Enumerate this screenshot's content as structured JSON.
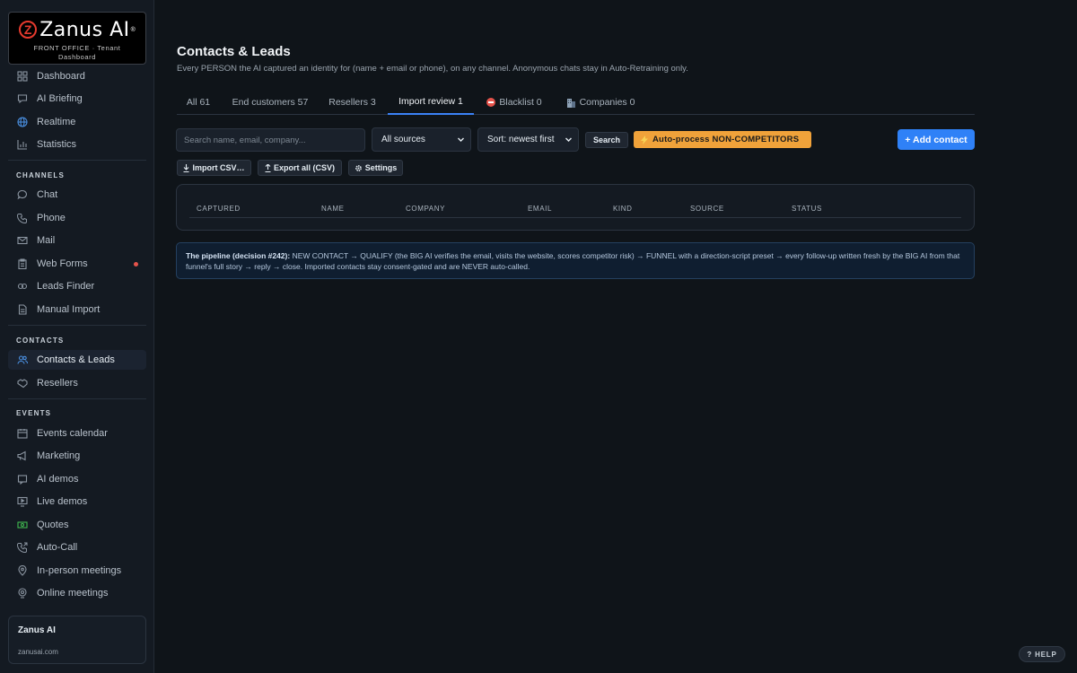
{
  "brand": {
    "name": "Zanus AI",
    "registered": "®",
    "subtitle": "FRONT OFFICE · Tenant",
    "subtitle2": "Dashboard",
    "accent_color": "#e63a2e"
  },
  "sidebar": {
    "top_items": [
      {
        "label": "Dashboard",
        "icon": "grid-icon"
      },
      {
        "label": "AI Briefing",
        "icon": "message-icon"
      },
      {
        "label": "Realtime",
        "icon": "globe-icon"
      },
      {
        "label": "Statistics",
        "icon": "bar-chart-icon"
      }
    ],
    "sections": {
      "channels": "CHANNELS",
      "contacts": "CONTACTS",
      "events": "EVENTS"
    },
    "channel_items": [
      {
        "label": "Chat",
        "icon": "chat-icon"
      },
      {
        "label": "Phone",
        "icon": "phone-icon"
      },
      {
        "label": "Mail",
        "icon": "mail-icon"
      },
      {
        "label": "Web Forms",
        "icon": "clipboard-icon"
      },
      {
        "label": "Leads Finder",
        "icon": "leads-icon"
      },
      {
        "label": "Manual Import",
        "icon": "file-icon"
      }
    ],
    "contact_items": [
      {
        "label": "Contacts & Leads",
        "icon": "users-icon"
      },
      {
        "label": "Resellers",
        "icon": "handshake-icon"
      }
    ],
    "event_items": [
      {
        "label": "Events calendar",
        "icon": "calendar-icon"
      },
      {
        "label": "Marketing",
        "icon": "megaphone-icon"
      },
      {
        "label": "AI demos",
        "icon": "bot-icon"
      },
      {
        "label": "Live demos",
        "icon": "monitor-icon"
      },
      {
        "label": "Quotes",
        "icon": "money-icon"
      },
      {
        "label": "Auto-Call",
        "icon": "phone-forward-icon"
      },
      {
        "label": "In-person meetings",
        "icon": "map-pin-icon"
      },
      {
        "label": "Online meetings",
        "icon": "webcam-icon"
      }
    ],
    "tenant": {
      "name": "Zanus AI",
      "url": "zanusai.com"
    }
  },
  "page": {
    "title": "Contacts & Leads",
    "subtitle": "Every PERSON the AI captured an identity for (name + email or phone), on any channel. Anonymous chats stay in Auto-Retraining only."
  },
  "tabs": [
    {
      "label": "All 61"
    },
    {
      "label": "End customers 57"
    },
    {
      "label": "Resellers 3"
    },
    {
      "label": "Import review 1",
      "active": true
    },
    {
      "label": "Blacklist 0",
      "icon": "no-entry-icon"
    },
    {
      "label": "Companies 0",
      "icon": "building-icon"
    }
  ],
  "toolbar": {
    "search_placeholder": "Search name, email, company...",
    "source_select": "All sources",
    "sort_select": "Sort: newest first",
    "search_button": "Search",
    "auto_process_button": "Auto-process NON-COMPETITORS",
    "add_contact_button": "+ Add contact",
    "import_button": "Import CSV…",
    "export_button": "Export all (CSV)",
    "settings_button": "Settings"
  },
  "table": {
    "columns": [
      "CAPTURED",
      "NAME",
      "COMPANY",
      "EMAIL",
      "KIND",
      "SOURCE",
      "STATUS"
    ],
    "rows": []
  },
  "info": {
    "lead": "The pipeline (decision #242):",
    "text": " NEW CONTACT → QUALIFY (the BIG AI verifies the email, visits the website, scores competitor risk) → FUNNEL with a direction-script preset → every follow-up written fresh by the BIG AI from that funnel's full story → reply → close. Imported contacts stay consent-gated and are NEVER auto-called."
  },
  "help_button": "? HELP",
  "colors": {
    "background": "#0f1419",
    "sidebar": "#141a22",
    "accent_blue": "#2f81f7",
    "accent_orange": "#f0a23a",
    "notification_dot": "#e5534b"
  }
}
